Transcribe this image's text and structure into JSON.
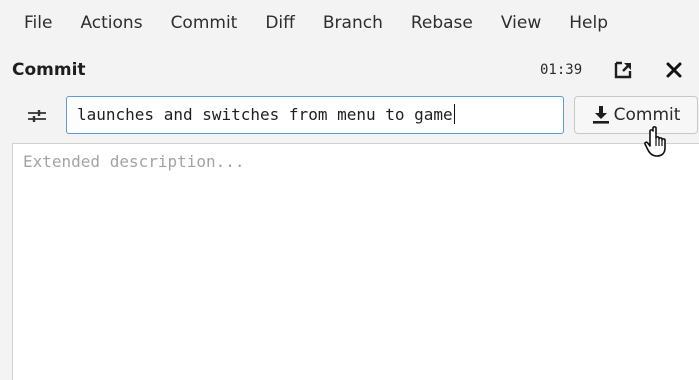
{
  "menubar": {
    "items": [
      "File",
      "Actions",
      "Commit",
      "Diff",
      "Branch",
      "Rebase",
      "View",
      "Help"
    ]
  },
  "panel": {
    "title": "Commit",
    "clock": "01:39",
    "detach_icon": "detach-window-icon",
    "close_icon": "close-icon"
  },
  "toolbar": {
    "options_icon": "sliders-icon",
    "summary_value": "launches and switches from menu to game",
    "commit_label": "Commit",
    "commit_icon": "download-arrow-icon"
  },
  "description": {
    "placeholder": "Extended description..."
  },
  "cursor": "hand-pointer-icon"
}
